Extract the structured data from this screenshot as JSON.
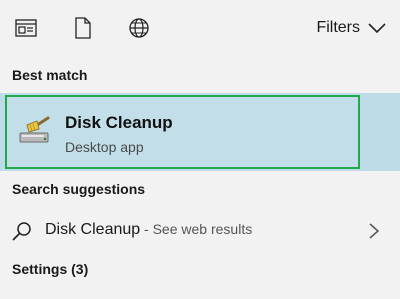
{
  "toolbar": {
    "icons": [
      "all-results-icon",
      "documents-icon",
      "web-icon"
    ],
    "filters_label": "Filters"
  },
  "best_match": {
    "heading": "Best match",
    "title": "Disk Cleanup",
    "subtitle": "Desktop app",
    "icon": "disk-cleanup-icon"
  },
  "search_suggestions": {
    "heading": "Search suggestions",
    "items": [
      {
        "query": "Disk Cleanup",
        "suffix": " - See web results"
      }
    ]
  },
  "settings": {
    "heading": "Settings (3)"
  },
  "colors": {
    "background": "#f2f2f2",
    "highlight": "#bedbe8",
    "focus_border": "#22a84a"
  }
}
